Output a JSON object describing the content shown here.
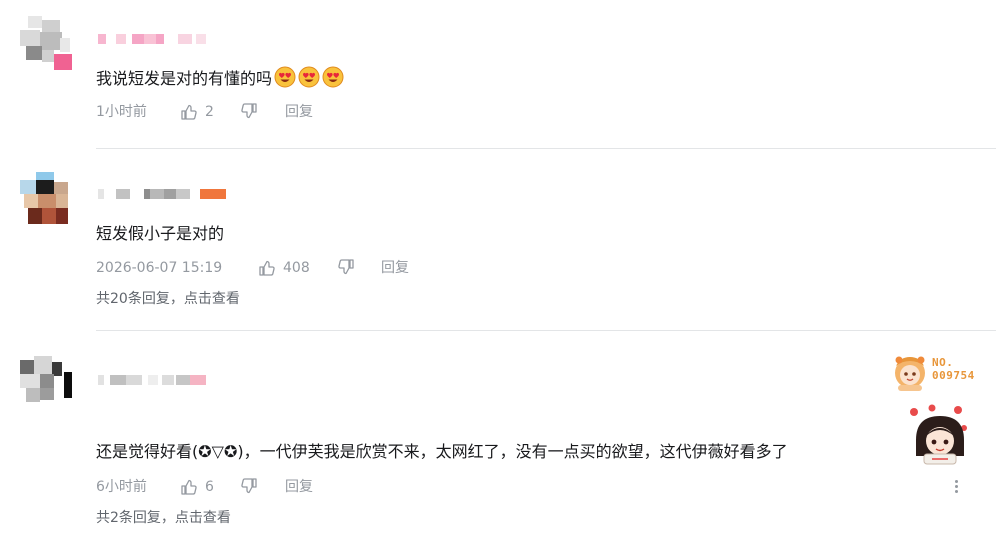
{
  "colors": {
    "text": "#18191c",
    "meta": "#9499a0",
    "divider": "#e3e5e7",
    "badge_orange": "#e8963a",
    "name_pink": "#f5a5c5",
    "name_orange": "#f0763c"
  },
  "comments": [
    {
      "text": "我说短发是对的有懂的吗",
      "emojis": [
        "heart-eyes-emoji",
        "heart-eyes-emoji",
        "heart-eyes-emoji"
      ],
      "time": "1小时前",
      "likes": "2",
      "reply_label": "回复"
    },
    {
      "text": "短发假小子是对的",
      "time": "2026-06-07 15:19",
      "likes": "408",
      "reply_label": "回复",
      "reply_summary": "共20条回复，点击查看"
    },
    {
      "text": "还是觉得好看(✪▽✪)，一代伊芙我是欣赏不来，太网红了，没有一点买的欲望，这代伊薇好看多了",
      "time": "6小时前",
      "likes": "6",
      "reply_label": "回复",
      "reply_summary": "共2条回复，点击查看",
      "badge_number": "NO.\n009754"
    }
  ],
  "icons": [
    "thumb-up-icon",
    "thumb-down-icon",
    "more-icon"
  ]
}
